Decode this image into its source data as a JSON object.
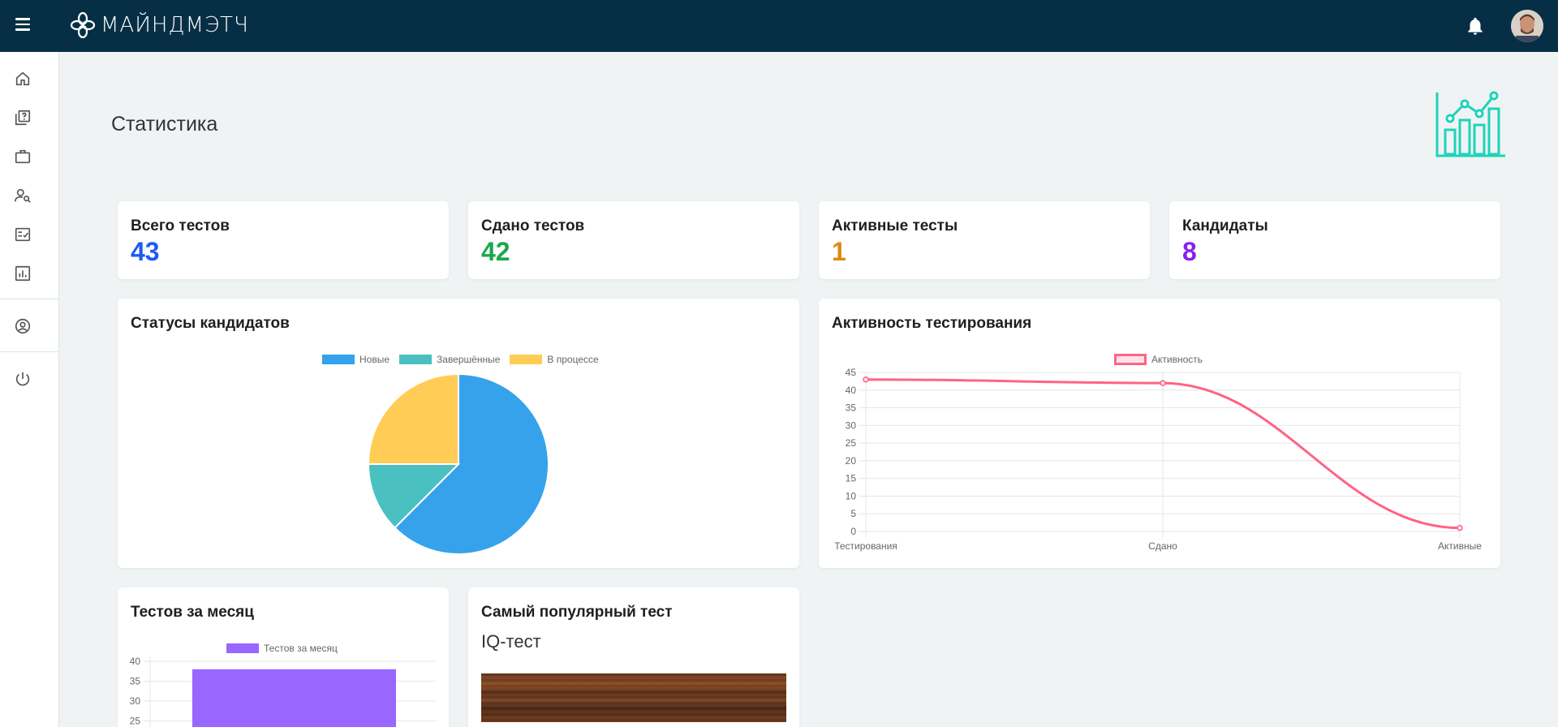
{
  "app": {
    "brand": "МАЙНДМЭТЧ"
  },
  "page": {
    "title": "Статистика"
  },
  "sidebar": {
    "items": [
      {
        "icon": "home-icon"
      },
      {
        "icon": "quiz-icon"
      },
      {
        "icon": "briefcase-icon"
      },
      {
        "icon": "user-search-icon"
      },
      {
        "icon": "checklist-icon"
      },
      {
        "icon": "bar-chart-icon"
      },
      {
        "icon": "account-circle-icon"
      },
      {
        "icon": "power-icon"
      }
    ]
  },
  "stat_cards": [
    {
      "label": "Всего тестов",
      "value": "43",
      "color": "#1d5cf0"
    },
    {
      "label": "Сдано тестов",
      "value": "42",
      "color": "#1aa84b"
    },
    {
      "label": "Активные тесты",
      "value": "1",
      "color": "#d98a13"
    },
    {
      "label": "Кандидаты",
      "value": "8",
      "color": "#8a1ef0"
    }
  ],
  "candidates_status": {
    "title": "Статусы кандидатов"
  },
  "activity": {
    "title": "Активность тестирования"
  },
  "monthly": {
    "title": "Тестов за месяц"
  },
  "popular": {
    "title": "Самый популярный тест",
    "test_name": "IQ-тест"
  },
  "chart_data": [
    {
      "type": "pie",
      "title": "",
      "labels": [
        "Новые",
        "Завершённые",
        "В процессе"
      ],
      "values": [
        5,
        1,
        2
      ],
      "colors": [
        "#36a2eb",
        "#4bc0c0",
        "#ffcd56"
      ],
      "legend": "top"
    },
    {
      "type": "line",
      "title": "",
      "categories": [
        "Тестирования",
        "Сдано",
        "Активные"
      ],
      "series": [
        {
          "name": "Активность",
          "values": [
            43,
            42,
            1
          ],
          "color": "#ff6384"
        }
      ],
      "ylim": [
        0,
        45
      ],
      "yticks": [
        0,
        5,
        10,
        15,
        20,
        25,
        30,
        35,
        40,
        45
      ],
      "grid": true,
      "legend": "top"
    },
    {
      "type": "bar",
      "title": "",
      "categories": [
        ""
      ],
      "series": [
        {
          "name": "Тестов за месяц",
          "values": [
            38
          ],
          "color": "#9966ff"
        }
      ],
      "ylim": [
        0,
        40
      ],
      "yticks_visible": [
        25,
        30,
        35,
        40
      ],
      "grid": true,
      "legend": "top"
    }
  ]
}
